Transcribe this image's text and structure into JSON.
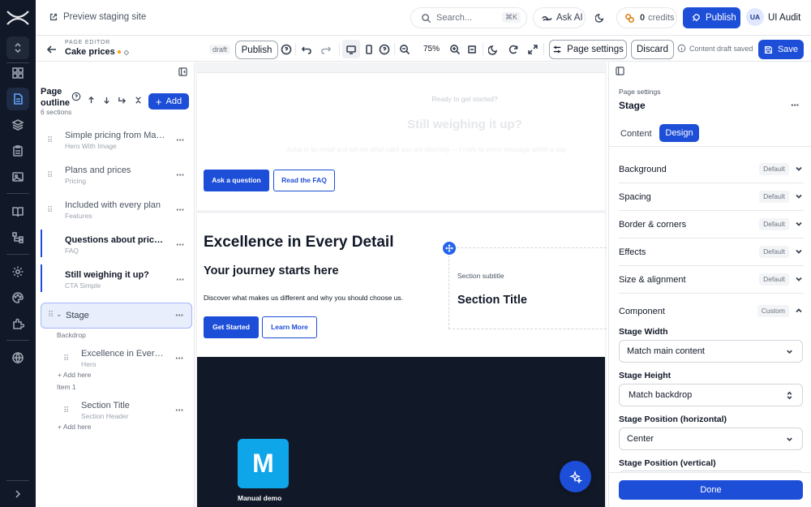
{
  "topbar": {
    "preview_label": "Preview staging site",
    "search_placeholder": "Search...",
    "search_shortcut": "⌘K",
    "ask_ai": "Ask AI",
    "credits_count": "0",
    "credits_label": "credits",
    "publish": "Publish",
    "user_initials": "UA",
    "user_name": "UI Audit"
  },
  "editor": {
    "section_label": "PAGE EDITOR",
    "page_name": "Cake prices",
    "draft_badge": "draft",
    "publish": "Publish",
    "zoom": "75%",
    "page_settings": "Page settings",
    "discard": "Discard",
    "saved_status": "Content draft saved",
    "save": "Save"
  },
  "outline": {
    "title_line1": "Page",
    "title_line2": "outline",
    "count": "6 sections",
    "add": "Add",
    "items": [
      {
        "title": "Simple pricing from Man...",
        "subtitle": "Hero With Image"
      },
      {
        "title": "Plans and prices",
        "subtitle": "Pricing"
      },
      {
        "title": "Included with every plan",
        "subtitle": "Features"
      },
      {
        "title": "Questions about pricing",
        "subtitle": "FAQ"
      },
      {
        "title": "Still weighing it up?",
        "subtitle": "CTA Simple"
      }
    ],
    "stage": {
      "title": "Stage",
      "backdrop_label": "Backdrop",
      "backdrop_item": {
        "title": "Excellence in Every ...",
        "subtitle": "Hero"
      },
      "add_here_1": "Add here",
      "item1_label": "Item 1",
      "item1_item": {
        "title": "Section Title",
        "subtitle": "Section Header"
      },
      "add_here_2": "Add here"
    }
  },
  "canvas": {
    "cta_kicker": "Ready to get started?",
    "cta_title": "Still weighing it up?",
    "cta_body": "Jump in by email and tell me what cake you are planning — I reply to every message within a day.",
    "cta_primary": "Ask a question",
    "cta_secondary": "Read the FAQ",
    "hero_title": "Excellence in Every Detail",
    "hero_subtitle": "Your journey starts here",
    "hero_body": "Discover what makes us different and why you should choose us.",
    "hero_primary": "Get Started",
    "hero_secondary": "Learn More",
    "card_subtitle": "Section subtitle",
    "card_title": "Section Title",
    "logo_letter": "M",
    "logo_caption": "Manual demo"
  },
  "panel": {
    "breadcrumb": "Page settings",
    "title": "Stage",
    "tab_content": "Content",
    "tab_design": "Design",
    "sections": [
      {
        "label": "Background",
        "badge": "Default"
      },
      {
        "label": "Spacing",
        "badge": "Default"
      },
      {
        "label": "Border & corners",
        "badge": "Default"
      },
      {
        "label": "Effects",
        "badge": "Default"
      },
      {
        "label": "Size & alignment",
        "badge": "Default"
      }
    ],
    "component": {
      "label": "Component",
      "badge": "Custom"
    },
    "stage_width_label": "Stage Width",
    "stage_width_value": "Match main content",
    "stage_height_label": "Stage Height",
    "stage_height_value": "Match backdrop",
    "stage_pos_h_label": "Stage Position (horizontal)",
    "stage_pos_h_value": "Center",
    "stage_pos_v_label": "Stage Position (vertical)",
    "done": "Done"
  },
  "colors": {
    "accent": "#1d4ed8",
    "rail_bg": "#111827",
    "canvas_dark": "#111827",
    "logo_bg": "#0ea5e9",
    "draft_dot": "#f59e0b"
  }
}
